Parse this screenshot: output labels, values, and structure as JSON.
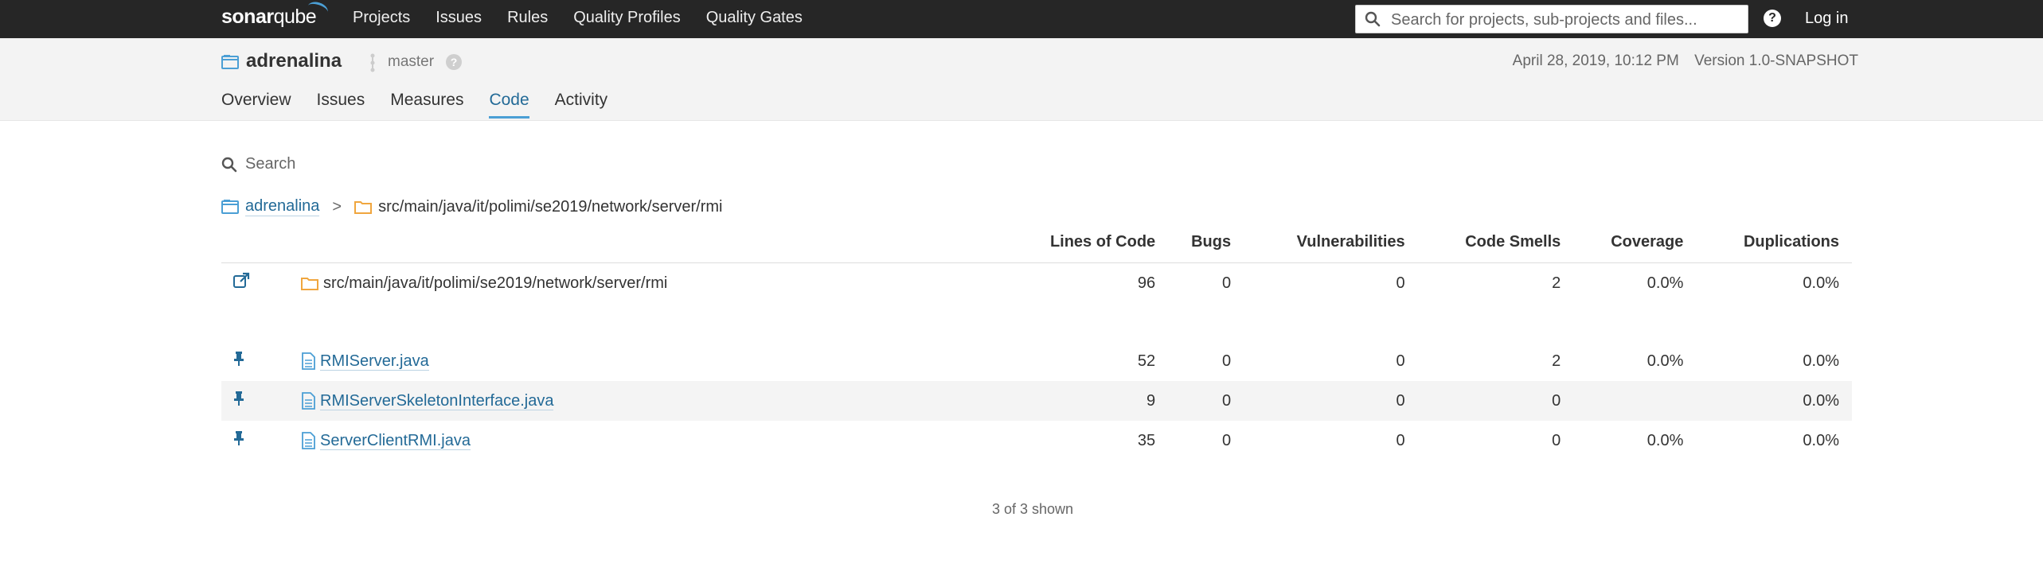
{
  "app": {
    "logo_bold": "sonar",
    "logo_rest": "qube",
    "nav": [
      "Projects",
      "Issues",
      "Rules",
      "Quality Profiles",
      "Quality Gates"
    ],
    "search_placeholder": "Search for projects, sub-projects and files...",
    "help": "?",
    "login": "Log in"
  },
  "project": {
    "name": "adrenalina",
    "branch": "master",
    "date": "April 28, 2019, 10:12 PM",
    "version": "Version 1.0-SNAPSHOT",
    "tabs": [
      "Overview",
      "Issues",
      "Measures",
      "Code",
      "Activity"
    ],
    "active_tab": "Code"
  },
  "code": {
    "search_placeholder": "Search",
    "breadcrumb": {
      "root": "adrenalina",
      "separator": ">",
      "path": "src/main/java/it/polimi/se2019/network/server/rmi"
    },
    "columns": [
      "Lines of Code",
      "Bugs",
      "Vulnerabilities",
      "Code Smells",
      "Coverage",
      "Duplications"
    ],
    "base_row": {
      "name": "src/main/java/it/polimi/se2019/network/server/rmi",
      "loc": "96",
      "bugs": "0",
      "vulns": "0",
      "smells": "2",
      "coverage": "0.0%",
      "dup": "0.0%"
    },
    "files": [
      {
        "name": "RMIServer.java",
        "loc": "52",
        "bugs": "0",
        "vulns": "0",
        "smells": "2",
        "coverage": "0.0%",
        "dup": "0.0%"
      },
      {
        "name": "RMIServerSkeletonInterface.java",
        "loc": "9",
        "bugs": "0",
        "vulns": "0",
        "smells": "0",
        "coverage": "",
        "dup": "0.0%"
      },
      {
        "name": "ServerClientRMI.java",
        "loc": "35",
        "bugs": "0",
        "vulns": "0",
        "smells": "0",
        "coverage": "0.0%",
        "dup": "0.0%"
      }
    ],
    "shown": "3 of 3 shown"
  },
  "colors": {
    "topbar": "#262626",
    "link": "#236a97",
    "accent": "#4b9fd5",
    "folder": "#f0a63e"
  }
}
